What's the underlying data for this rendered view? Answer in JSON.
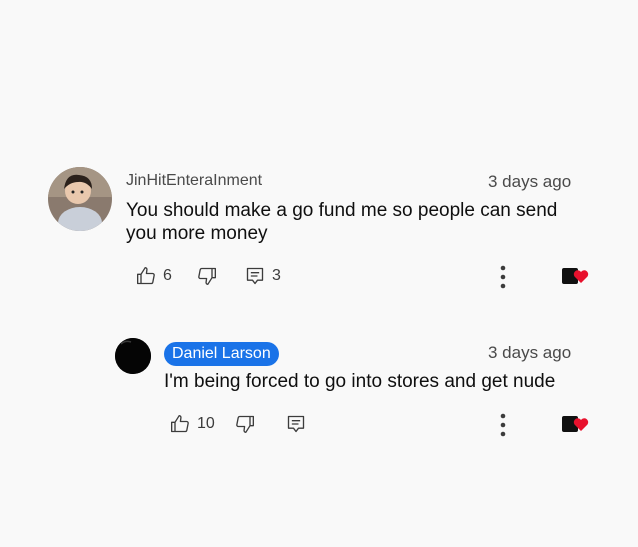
{
  "comments": [
    {
      "author": "JinHitEnteraInment",
      "time": "3 days ago",
      "text": "You should make a go fund me so people can send you more money",
      "likes": "6",
      "replies": "3"
    },
    {
      "author": "Daniel Larson",
      "time": "3 days ago",
      "text": "I'm being forced to go into stores and get nude",
      "likes": "10"
    }
  ],
  "colors": {
    "author_highlight": "#1a73e8",
    "heart": "#e8112d",
    "background": "#f9f9f9"
  },
  "icons": [
    "thumbs-up-icon",
    "thumbs-down-icon",
    "reply-icon",
    "more-vert-icon",
    "creator-heart-icon"
  ]
}
